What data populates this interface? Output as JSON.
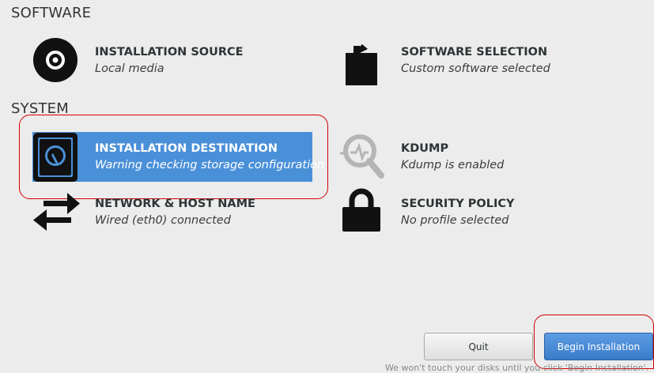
{
  "sections": {
    "software": "SOFTWARE",
    "system": "SYSTEM"
  },
  "spokes": {
    "installation_source": {
      "title": "INSTALLATION SOURCE",
      "status": "Local media",
      "icon": "disc-icon"
    },
    "software_selection": {
      "title": "SOFTWARE SELECTION",
      "status": "Custom software selected",
      "icon": "package-icon"
    },
    "installation_destination": {
      "title": "INSTALLATION DESTINATION",
      "status": "Warning checking storage configuration",
      "icon": "harddisk-icon"
    },
    "kdump": {
      "title": "KDUMP",
      "status": "Kdump is enabled",
      "icon": "magnifier-icon"
    },
    "network": {
      "title": "NETWORK & HOST NAME",
      "status": "Wired (eth0) connected",
      "icon": "network-arrows-icon"
    },
    "security_policy": {
      "title": "SECURITY POLICY",
      "status": "No profile selected",
      "icon": "lock-icon"
    }
  },
  "buttons": {
    "quit": "Quit",
    "begin": "Begin Installation"
  },
  "footnote": "We won't touch your disks until you click 'Begin Installation'.",
  "colors": {
    "background": "#ececec",
    "selected": "#4a90d9",
    "highlight_outline": "#d40000",
    "begin_button": "#3a7cc9"
  }
}
